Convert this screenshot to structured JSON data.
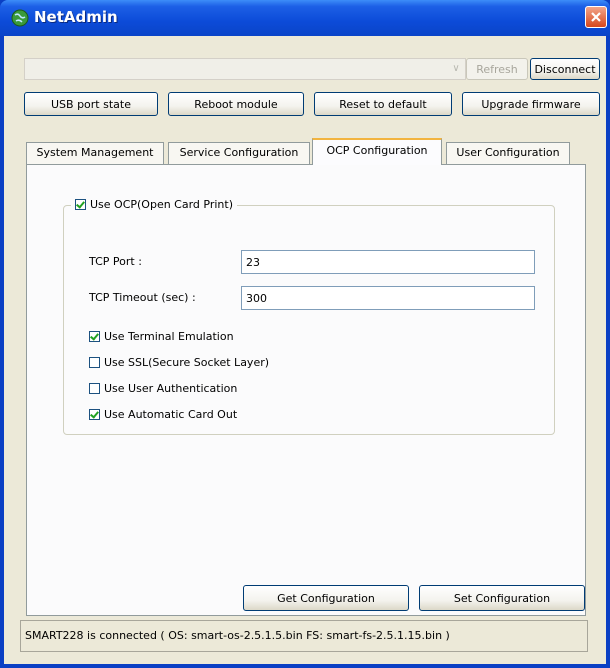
{
  "window": {
    "title": "NetAdmin"
  },
  "toolbar": {
    "device_combo_value": "",
    "refresh_label": "Refresh",
    "disconnect_label": "Disconnect",
    "usb_label": "USB port state",
    "reboot_label": "Reboot module",
    "reset_label": "Reset to default",
    "upgrade_label": "Upgrade firmware"
  },
  "tabs": [
    {
      "label": "System Management",
      "active": false
    },
    {
      "label": "Service Configuration",
      "active": false
    },
    {
      "label": "OCP Configuration",
      "active": true
    },
    {
      "label": "User Configuration",
      "active": false
    }
  ],
  "ocp": {
    "group_label": "Use OCP(Open Card Print)",
    "group_checked": true,
    "tcp_port_label": "TCP Port :",
    "tcp_port_value": "23",
    "tcp_timeout_label": "TCP Timeout (sec) :",
    "tcp_timeout_value": "300",
    "options": [
      {
        "label": "Use Terminal Emulation",
        "checked": true
      },
      {
        "label": "Use SSL(Secure Socket Layer)",
        "checked": false
      },
      {
        "label": "Use User Authentication",
        "checked": false
      },
      {
        "label": "Use Automatic Card Out",
        "checked": true
      }
    ]
  },
  "actions": {
    "get_label": "Get Configuration",
    "set_label": "Set Configuration"
  },
  "status": {
    "text": "SMART228 is connected ( OS: smart-os-2.5.1.5.bin  FS: smart-fs-2.5.1.15.bin )"
  },
  "colors": {
    "titlebar": "#0c4bd8",
    "active_tab_accent": "#f2b43f",
    "check_mark": "#21a121"
  }
}
